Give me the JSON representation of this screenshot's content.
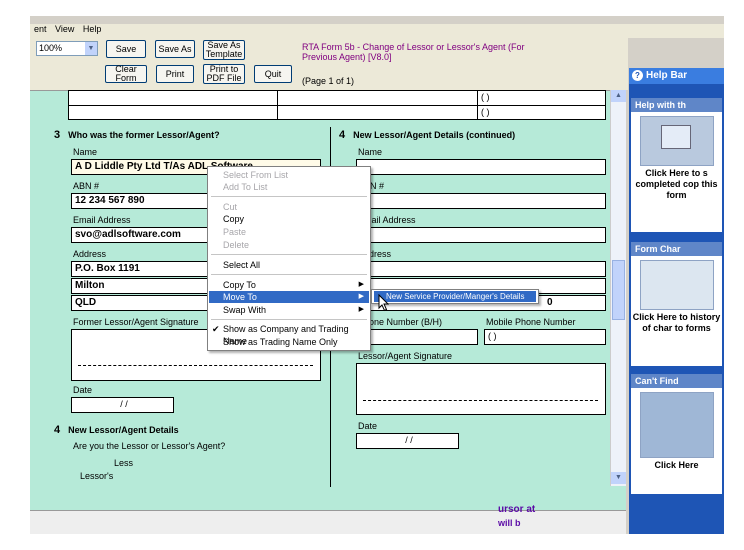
{
  "menu": [
    "ent",
    "View",
    "Help"
  ],
  "toolbar": {
    "zoom": "100%",
    "save": "Save",
    "save_as": "Save As",
    "save_as_template": "Save As Template",
    "clear_form": "Clear Form",
    "print": "Print",
    "print_pdf": "Print to PDF File",
    "quit": "Quit"
  },
  "form_title": "RTA Form  5b - Change of Lessor or Lessor's Agent (For Previous Agent) [V8.0]",
  "page_indicator": "(Page 1 of 1)",
  "top_phone_fields": [
    "(   )",
    "(   )"
  ],
  "section3": {
    "number": "3",
    "title": "Who was the former Lessor/Agent?",
    "name_label": "Name",
    "name_value": "A D Liddle Pty Ltd T/As ADL Software",
    "abn_label": "ABN #",
    "abn_value": "12 234 567 890",
    "email_label": "Email Address",
    "email_value": "svo@adlsoftware.com",
    "address_label": "Address",
    "address_lines": [
      "P.O. Box 1191",
      "Milton",
      "QLD"
    ],
    "signature_label": "Former Lessor/Agent Signature",
    "date_label": "Date",
    "date_value": "/   /"
  },
  "section4_left": {
    "number": "4",
    "title": "New Lessor/Agent Details",
    "question": "Are you the Lessor or Lessor's Agent?",
    "partial1": "Less",
    "partial2": "Lessor's"
  },
  "section4_right": {
    "number": "4",
    "title": "New Lessor/Agent Details (continued)",
    "name_label": "Name",
    "abn_label": "ABN #",
    "email_label": "Email Address",
    "address_label": "Address",
    "postcode_value": "0",
    "phone_label": "Phone Number (B/H)",
    "mobile_label": "Mobile Phone Number",
    "mobile_value": "(   )",
    "signature_label": "Lessor/Agent Signature",
    "date_label": "Date",
    "date_value": "/   /"
  },
  "context_menu": {
    "items": [
      {
        "label": "Select From List",
        "disabled": true
      },
      {
        "label": "Add To List",
        "disabled": true
      },
      {
        "label": "Cut",
        "disabled": true
      },
      {
        "label": "Copy",
        "disabled": false
      },
      {
        "label": "Paste",
        "disabled": true
      },
      {
        "label": "Delete",
        "disabled": true
      },
      {
        "label": "Select All",
        "disabled": false
      },
      {
        "label": "Copy To",
        "disabled": false
      },
      {
        "label": "Move To",
        "disabled": false
      },
      {
        "label": "Swap With",
        "disabled": false
      },
      {
        "label": "Show as Company and Trading Name",
        "disabled": false
      },
      {
        "label": "Show as Trading Name Only",
        "disabled": false
      }
    ],
    "submenu_item": "New Service Provider/Manger's Details"
  },
  "help_bar": {
    "title": "Help Bar",
    "panel1_title": "Help with th",
    "panel1_text": "Click Here to s completed cop this form",
    "panel2_title": "Form Char",
    "panel2_text": "Click Here to history of char to forms",
    "panel3_title": "Can't Find Somethin",
    "panel3_text": "Click Here"
  },
  "bottom": {
    "text1": "ursor at",
    "text2": "will b"
  },
  "colors": {
    "form_bg": "#b6ead8",
    "help_blue": "#1e55b5",
    "title_purple": "#800080",
    "highlight": "#316ac5"
  }
}
